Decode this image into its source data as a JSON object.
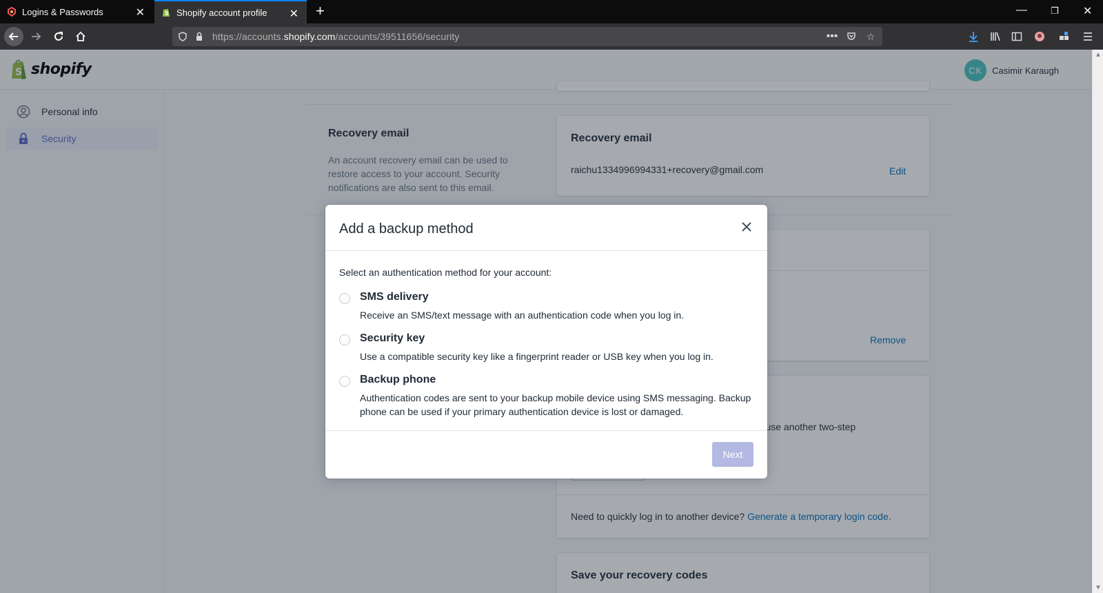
{
  "browser": {
    "tabs": [
      {
        "title": "Logins & Passwords"
      },
      {
        "title": "Shopify account profile"
      }
    ],
    "url": {
      "prefix": "https://accounts.",
      "domain": "shopify.com",
      "path": "/accounts/39511656/security"
    },
    "accent": "#0a84ff"
  },
  "header": {
    "logo_text": "shopify",
    "user": {
      "initials": "CK",
      "name": "Casimir Karaugh"
    }
  },
  "sidebar": {
    "items": [
      {
        "label": "Personal info",
        "icon": "user-circle-icon",
        "active": false
      },
      {
        "label": "Security",
        "icon": "lock-icon",
        "active": true
      }
    ]
  },
  "main": {
    "recovery_section": {
      "title": "Recovery email",
      "description": "An account recovery email can be used to restore access to your account. Security notifications are also sent to this email."
    },
    "recovery_card": {
      "heading": "Recovery email",
      "email": "raichu1334996994331+recovery@gmail.com",
      "edit_label": "Edit"
    },
    "remove_label": "Remove",
    "partial_text": "an use another two-step",
    "temp_login": {
      "prompt": "Need to quickly log in to another device?",
      "link": "Generate a temporary login code."
    },
    "recovery_codes_heading": "Save your recovery codes"
  },
  "modal": {
    "title": "Add a backup method",
    "intro": "Select an authentication method for your account:",
    "options": [
      {
        "title": "SMS delivery",
        "description": "Receive an SMS/text message with an authentication code when you log in."
      },
      {
        "title": "Security key",
        "description": "Use a compatible security key like a fingerprint reader or USB key when you log in."
      },
      {
        "title": "Backup phone",
        "description": "Authentication codes are sent to your backup mobile device using SMS messaging. Backup phone can be used if your primary authentication device is lost or damaged."
      }
    ],
    "next_label": "Next",
    "brand_color": "#5c6ac4"
  }
}
